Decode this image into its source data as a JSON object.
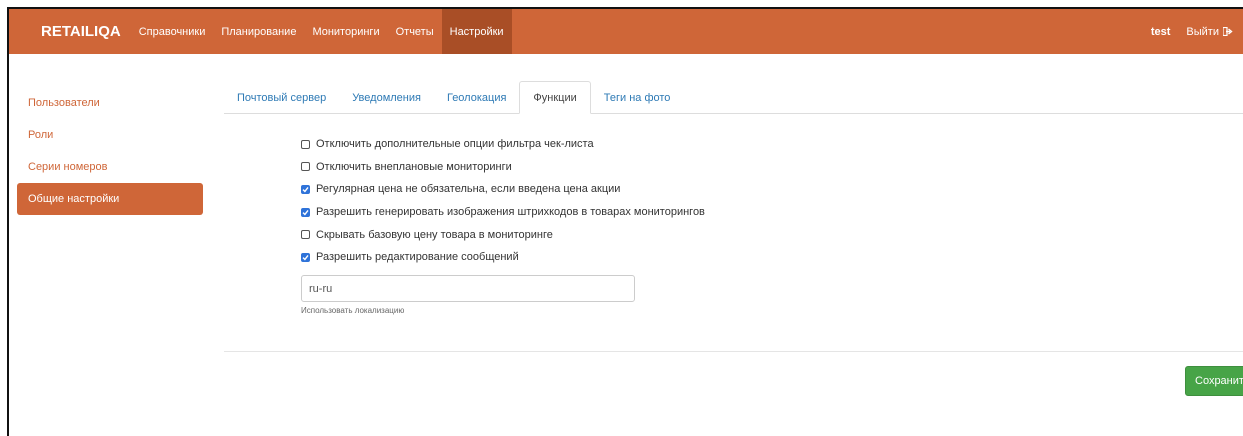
{
  "navbar": {
    "brand": "RETAILIQA",
    "items": [
      {
        "label": "Справочники"
      },
      {
        "label": "Планирование"
      },
      {
        "label": "Мониторинги"
      },
      {
        "label": "Отчеты"
      },
      {
        "label": "Настройки"
      }
    ],
    "active_index": 4,
    "user": "test",
    "logout_label": "Выйти",
    "logout_icon": "sign-out-icon"
  },
  "sidebar": {
    "items": [
      {
        "label": "Пользователи"
      },
      {
        "label": "Роли"
      },
      {
        "label": "Серии номеров"
      },
      {
        "label": "Общие настройки"
      }
    ],
    "active_index": 3
  },
  "tabs": {
    "items": [
      {
        "label": "Почтовый сервер"
      },
      {
        "label": "Уведомления"
      },
      {
        "label": "Геолокация"
      },
      {
        "label": "Функции"
      },
      {
        "label": "Теги на фото"
      }
    ],
    "active_index": 3
  },
  "options": [
    {
      "label": "Отключить дополнительные опции фильтра чек-листа",
      "checked": false
    },
    {
      "label": "Отключить внеплановые мониторинги",
      "checked": false
    },
    {
      "label": "Регулярная цена не обязательна, если введена цена акции",
      "checked": true
    },
    {
      "label": "Разрешить генерировать изображения штрихкодов в товарах мониторингов",
      "checked": true
    },
    {
      "label": "Скрывать базовую цену товара в мониторинге",
      "checked": false
    },
    {
      "label": "Разрешить редактирование сообщений",
      "checked": true
    }
  ],
  "locale": {
    "value": "ru-ru",
    "help": "Использовать локализацию"
  },
  "save_label": "Сохранить",
  "colors": {
    "brand": "#cf6638",
    "active_nav": "#a94e26",
    "link": "#2e7ab5",
    "checkbox": "#2f73d9",
    "save": "#47a447"
  }
}
